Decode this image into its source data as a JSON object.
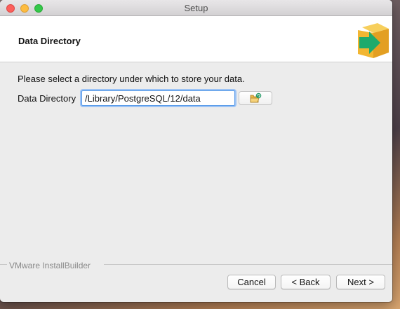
{
  "window": {
    "title": "Setup",
    "controls": [
      "close",
      "minimize",
      "zoom"
    ]
  },
  "header": {
    "title": "Data Directory",
    "logo_icon": "installer-box-arrow-icon"
  },
  "main": {
    "description": "Please select a directory under which to store your data.",
    "directory": {
      "label": "Data Directory",
      "value": "/Library/PostgreSQL/12/data",
      "browse_icon": "folder-browse-icon"
    }
  },
  "footer": {
    "brand": "VMware InstallBuilder",
    "buttons": {
      "cancel": "Cancel",
      "back": "< Back",
      "next": "Next >"
    }
  },
  "colors": {
    "close": "#fc605c",
    "minimize": "#fdbc40",
    "zoom": "#34c84a",
    "input_focus": "#5a9be8",
    "logo_box": "#f2b632",
    "logo_arrow": "#1faa6c"
  }
}
